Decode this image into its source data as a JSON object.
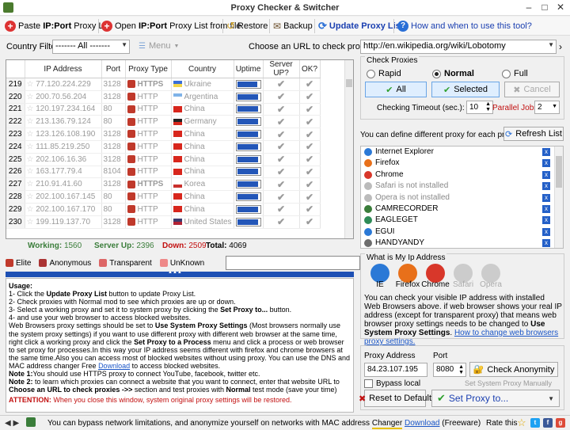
{
  "window": {
    "title": "Proxy Checker & Switcher"
  },
  "toolbar": {
    "paste_prefix": "Paste ",
    "paste_bold": "IP:Port",
    "paste_suffix": " Proxy List",
    "open_prefix": "Open ",
    "open_bold": "IP:Port",
    "open_suffix": " Proxy List from file",
    "restore": "Restore",
    "backup": "Backup",
    "update": "Update Proxy List",
    "howto": "How and when to use this tool?"
  },
  "filter": {
    "country_label": "Country Filter:",
    "country_value": "------- All -------",
    "menu_label": "Menu",
    "url_label": "Choose an URL to check proxies ->>",
    "url_value": "http://en.wikipedia.org/wiki/Lobotomy"
  },
  "grid": {
    "columns": [
      "IP Address",
      "Port",
      "Proxy Type",
      "Country",
      "Uptime",
      "Server UP?",
      "OK?"
    ],
    "rows": [
      {
        "num": "219",
        "ip": "77.120.224.229",
        "port": "3128",
        "type": "HTTPS",
        "country": "Ukraine",
        "flag": "#3a6fd8|#f3d64b",
        "uptime": 0.9
      },
      {
        "num": "220",
        "ip": "200.70.56.204",
        "port": "3128",
        "type": "HTTP",
        "country": "Argentina",
        "flag": "#7fb3e8|#ffffff",
        "uptime": 0.95
      },
      {
        "num": "221",
        "ip": "120.197.234.164",
        "port": "80",
        "type": "HTTP",
        "country": "China",
        "flag": "#d8261c|#d8261c",
        "uptime": 0.95
      },
      {
        "num": "222",
        "ip": "213.136.79.124",
        "port": "80",
        "type": "HTTP",
        "country": "Germany",
        "flag": "#222222|#d8261c",
        "uptime": 0.95
      },
      {
        "num": "223",
        "ip": "123.126.108.190",
        "port": "3128",
        "type": "HTTP",
        "country": "China",
        "flag": "#d8261c|#d8261c",
        "uptime": 0.95
      },
      {
        "num": "224",
        "ip": "111.85.219.250",
        "port": "3128",
        "type": "HTTP",
        "country": "China",
        "flag": "#d8261c|#d8261c",
        "uptime": 0.95
      },
      {
        "num": "225",
        "ip": "202.106.16.36",
        "port": "3128",
        "type": "HTTP",
        "country": "China",
        "flag": "#d8261c|#d8261c",
        "uptime": 0.95
      },
      {
        "num": "226",
        "ip": "163.177.79.4",
        "port": "8104",
        "type": "HTTP",
        "country": "China",
        "flag": "#d8261c|#d8261c",
        "uptime": 0.95
      },
      {
        "num": "227",
        "ip": "210.91.41.60",
        "port": "3128",
        "type": "HTTPS",
        "country": "Korea",
        "flag": "#ffffff|#c9302c",
        "uptime": 0.95
      },
      {
        "num": "228",
        "ip": "202.100.167.145",
        "port": "80",
        "type": "HTTP",
        "country": "China",
        "flag": "#d8261c|#d8261c",
        "uptime": 0.95
      },
      {
        "num": "229",
        "ip": "202.100.167.170",
        "port": "80",
        "type": "HTTP",
        "country": "China",
        "flag": "#d8261c|#d8261c",
        "uptime": 0.95
      },
      {
        "num": "230",
        "ip": "199.119.137.70",
        "port": "3128",
        "type": "HTTP",
        "country": "United States",
        "flag": "#3c3b6e|#b22234",
        "uptime": 0.95
      }
    ]
  },
  "status": {
    "working_label": "Working:",
    "working_value": "1560",
    "server_up_label": "Server Up:",
    "server_up_value": "2396",
    "down_label": "Down:",
    "down_value": "2509",
    "total_label": "Total:",
    "total_value": "4069"
  },
  "legend": [
    "Elite",
    "Anonymous",
    "Transparent",
    "UnKnown"
  ],
  "usage": {
    "heading": "Usage:",
    "l1a": "1-  Click the ",
    "l1b": "Update Proxy List",
    "l1c": " button to update Proxy List.",
    "l2": "2-  Check proxies with Normal mod to see which proxies are up or down.",
    "l3a": "3-  Select a working proxy and set it to system proxy by clicking the ",
    "l3b": "Set Proxy to...",
    "l3c": " button.",
    "l4": "4-  and use your web browser to access blocked websites.",
    "p1a": "Web Browsers proxy settings should be set to ",
    "p1b": "Use System Proxy Settings",
    "p1c": " (Most browsers normally use the system proxy settings) if you want to use different proxy with different web browser at the same time, right click a working proxy and click the ",
    "p1d": "Set Proxy to a Process",
    "p1e": " menu and click a process or web browser to set proxy for processes.In this way your IP address seems different with firefox and chrome browsers at the same time.Also you can access most of blocked websites without using proxy. You can use the DNS and MAC address changer Free ",
    "p1link": "Download",
    "p1f": " to access blocked websites.",
    "n1a": "Note 1:",
    "n1b": "You should use HTTPS proxy to connect YouTube, facebook, twitter etc.",
    "n2a": "Note 2:",
    "n2b": " to learn which proxies can connect a website that you want to connect, enter that website URL to ",
    "n2c": "Choose an URL to check proxies ->>",
    "n2d": " section and test proxies with ",
    "n2e": "Normal",
    "n2f": " test mode (save your time)",
    "attn_label": "ATTENTION:",
    "attn_text": " When you close this window, system original proxy settings will be restored."
  },
  "check_proxies": {
    "title": "Check Proxies",
    "modes": [
      "Rapid",
      "Normal",
      "Full"
    ],
    "selected_mode": "Normal",
    "all_btn": "All",
    "selected_btn": "Selected",
    "cancel_btn": "Cancel",
    "timeout_label": "Checking Timeout (sec.):",
    "timeout_value": "10",
    "jobs_label": "Parallel Jobs:",
    "jobs_value": "2"
  },
  "process": {
    "desc": "You can define different proxy for each process",
    "refresh": "Refresh List",
    "items": [
      {
        "name": "Internet Explorer",
        "color": "#2b79d6",
        "disabled": false
      },
      {
        "name": "Firefox",
        "color": "#e8701a",
        "disabled": false
      },
      {
        "name": "Chrome",
        "color": "#d8372a",
        "disabled": false
      },
      {
        "name": "Safari is not installed",
        "color": "#bbbbbb",
        "disabled": true
      },
      {
        "name": "Opera is not installed",
        "color": "#bbbbbb",
        "disabled": true
      },
      {
        "name": "CAMRECORDER",
        "color": "#3a7d3a",
        "disabled": false
      },
      {
        "name": "EAGLEGET",
        "color": "#2e8b57",
        "disabled": false
      },
      {
        "name": "EGUI",
        "color": "#2b79d6",
        "disabled": false
      },
      {
        "name": "HANDYANDY",
        "color": "#6d6d6d",
        "disabled": false
      }
    ]
  },
  "myip": {
    "title": "What is My Ip Address",
    "browsers": [
      {
        "name": "IE",
        "color": "#2b79d6",
        "disabled": false
      },
      {
        "name": "Firefox",
        "color": "#e8701a",
        "disabled": false
      },
      {
        "name": "Chrome",
        "color": "#d8372a",
        "disabled": false
      },
      {
        "name": "Safari",
        "color": "#cccccc",
        "disabled": true
      },
      {
        "name": "Opera",
        "color": "#cccccc",
        "disabled": true
      }
    ],
    "desc_a": "You can check your visible IP address with installed Web Browsers above. if web browser shows your real IP address (except for transparent proxy) that means web browser proxy settings needs to be changed to ",
    "desc_b": "Use System Proxy Settings",
    "desc_c": ".",
    "desc_link": "How to change web browsers proxy settings."
  },
  "proxy_set": {
    "addr_label": "Proxy Address",
    "addr_value": "84.23.107.195",
    "port_label": "Port",
    "port_value": "8080",
    "check_anon": "Check Anonymity",
    "bypass_label": "Bypass local",
    "manual_label": "Set System Proxy Manually",
    "reset_btn": "Reset to Default",
    "set_btn": "Set Proxy to..."
  },
  "footer": {
    "text_a": "You can bypass network limitations, and anonymize yourself on networks with MAC address ",
    "text_b": "Changer",
    "link": "Download",
    "text_c": " (Freeware)",
    "rate": "Rate this"
  }
}
